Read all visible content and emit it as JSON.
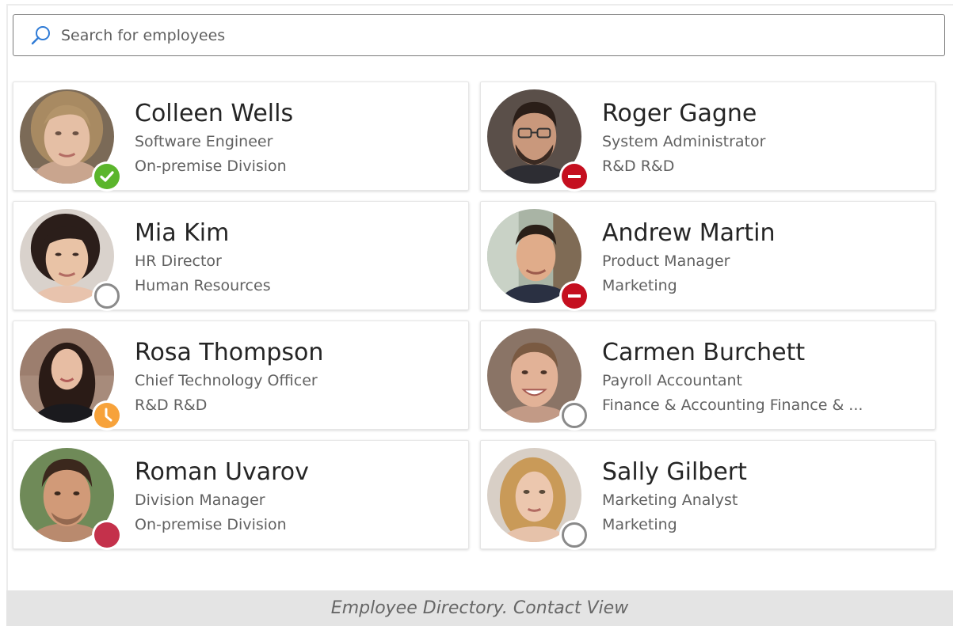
{
  "search": {
    "placeholder": "Search for employees",
    "value": ""
  },
  "colors": {
    "available": "#5bb52c",
    "busy": "#c50f1f",
    "away": "#f7a23a",
    "dnd_dot": "#c4314b",
    "offline": "#8a8a8a"
  },
  "employees": [
    {
      "name": "Colleen Wells",
      "title": "Software Engineer",
      "department": "On-premise Division",
      "status": "available"
    },
    {
      "name": "Roger Gagne",
      "title": "System Administrator",
      "department": "R&D R&D",
      "status": "busy"
    },
    {
      "name": "Mia Kim",
      "title": "HR Director",
      "department": "Human Resources",
      "status": "offline"
    },
    {
      "name": "Andrew Martin",
      "title": "Product Manager",
      "department": "Marketing",
      "status": "busy"
    },
    {
      "name": "Rosa Thompson",
      "title": "Chief Technology Officer",
      "department": "R&D R&D",
      "status": "away"
    },
    {
      "name": "Carmen Burchett",
      "title": "Payroll Accountant",
      "department": "Finance & Accounting Finance & ...",
      "status": "offline"
    },
    {
      "name": "Roman Uvarov",
      "title": "Division Manager",
      "department": "On-premise Division",
      "status": "busy-dot"
    },
    {
      "name": "Sally Gilbert",
      "title": "Marketing Analyst",
      "department": "Marketing",
      "status": "offline"
    }
  ],
  "caption": "Employee Directory. Contact View"
}
